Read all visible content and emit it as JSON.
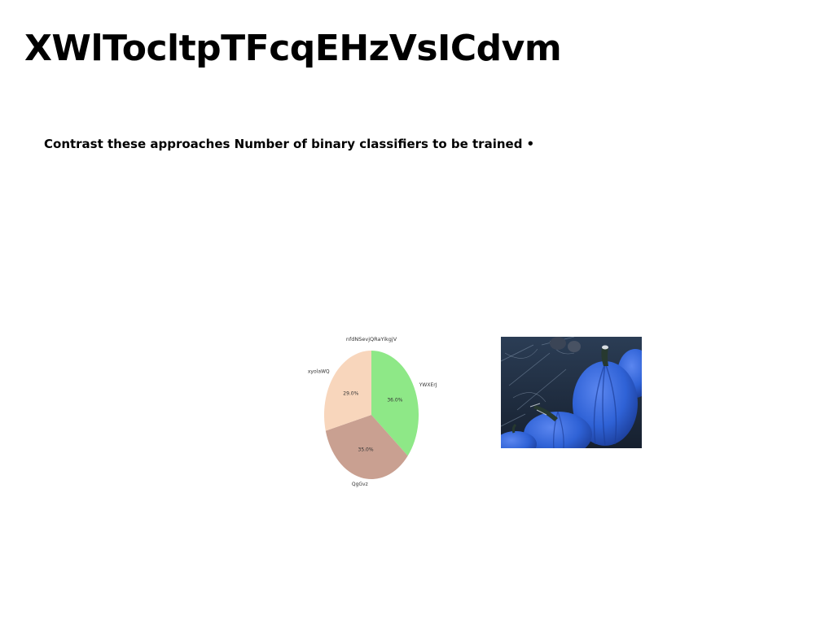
{
  "page": {
    "title": "XWlTocltpTFcqEHzVsICdvm",
    "subtitle": "Contrast these approaches Number of binary classifiers to be trained",
    "bullet": "•"
  },
  "chart_data": {
    "type": "pie",
    "title": "nfdNSevjQRaYikgjV",
    "categories": [
      "YWXErJ",
      "QgGvz",
      "xyolaWQ"
    ],
    "values": [
      36.0,
      35.0,
      29.0
    ],
    "value_labels": [
      "36.0%",
      "35.0%",
      "29.0%"
    ],
    "colors": [
      "#8ee887",
      "#c9a091",
      "#f8d6bc"
    ],
    "start_angle_deg": 90,
    "direction": "clockwise",
    "legend": "none"
  },
  "image": {
    "icon": "blue-pumpkins-photo",
    "colors": {
      "background": "#1e2e42",
      "pumpkin": "#2f62d6",
      "pumpkin_highlight": "#5b86ef",
      "stem": "#27392f"
    }
  }
}
